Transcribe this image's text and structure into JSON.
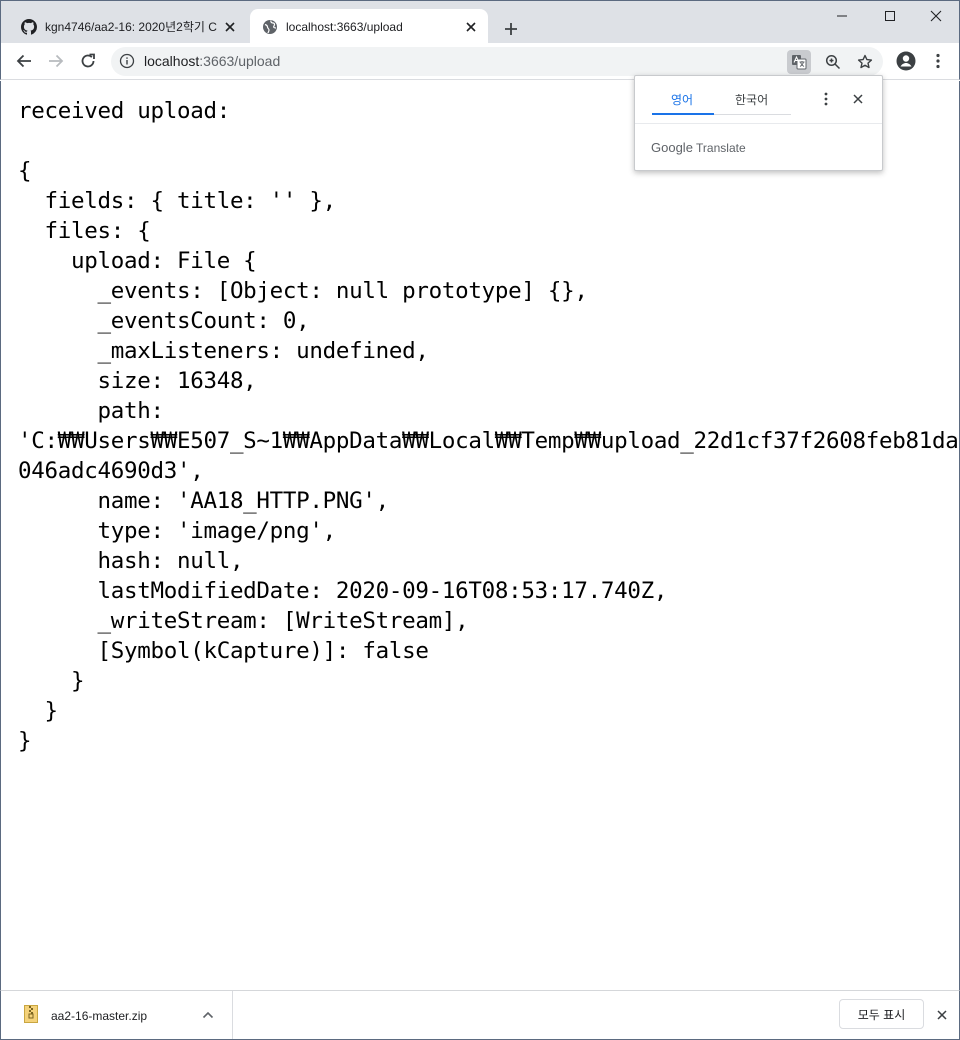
{
  "tabs": [
    {
      "title": "kgn4746/aa2-16: 2020년2학기 C",
      "favicon": "github-icon",
      "active": false
    },
    {
      "title": "localhost:3663/upload",
      "favicon": "globe-icon",
      "active": true
    }
  ],
  "toolbar": {
    "url_host": "localhost",
    "url_path": ":3663/upload"
  },
  "page": {
    "lines": [
      "received upload:",
      "",
      "{",
      "  fields: { title: '' },",
      "  files: {",
      "    upload: File {",
      "      _events: [Object: null prototype] {},",
      "      _eventsCount: 0,",
      "      _maxListeners: undefined,",
      "      size: 16348,",
      "      path:",
      "'C:₩₩Users₩₩E507_S~1₩₩AppData₩₩Local₩₩Temp₩₩upload_22d1cf37f2608feb81da",
      "046adc4690d3',",
      "      name: 'AA18_HTTP.PNG',",
      "      type: 'image/png',",
      "      hash: null,",
      "      lastModifiedDate: 2020-09-16T08:53:17.740Z,",
      "      _writeStream: [WriteStream],",
      "      [Symbol(kCapture)]: false",
      "    }",
      "  }",
      "}"
    ]
  },
  "translate_bubble": {
    "source_lang": "영어",
    "target_lang": "한국어",
    "brand_google": "Google",
    "brand_translate": "Translate",
    "accent_color": "#1a73e8"
  },
  "downloads": {
    "file_name": "aa2-16-master.zip",
    "show_all_label": "모두 표시"
  }
}
